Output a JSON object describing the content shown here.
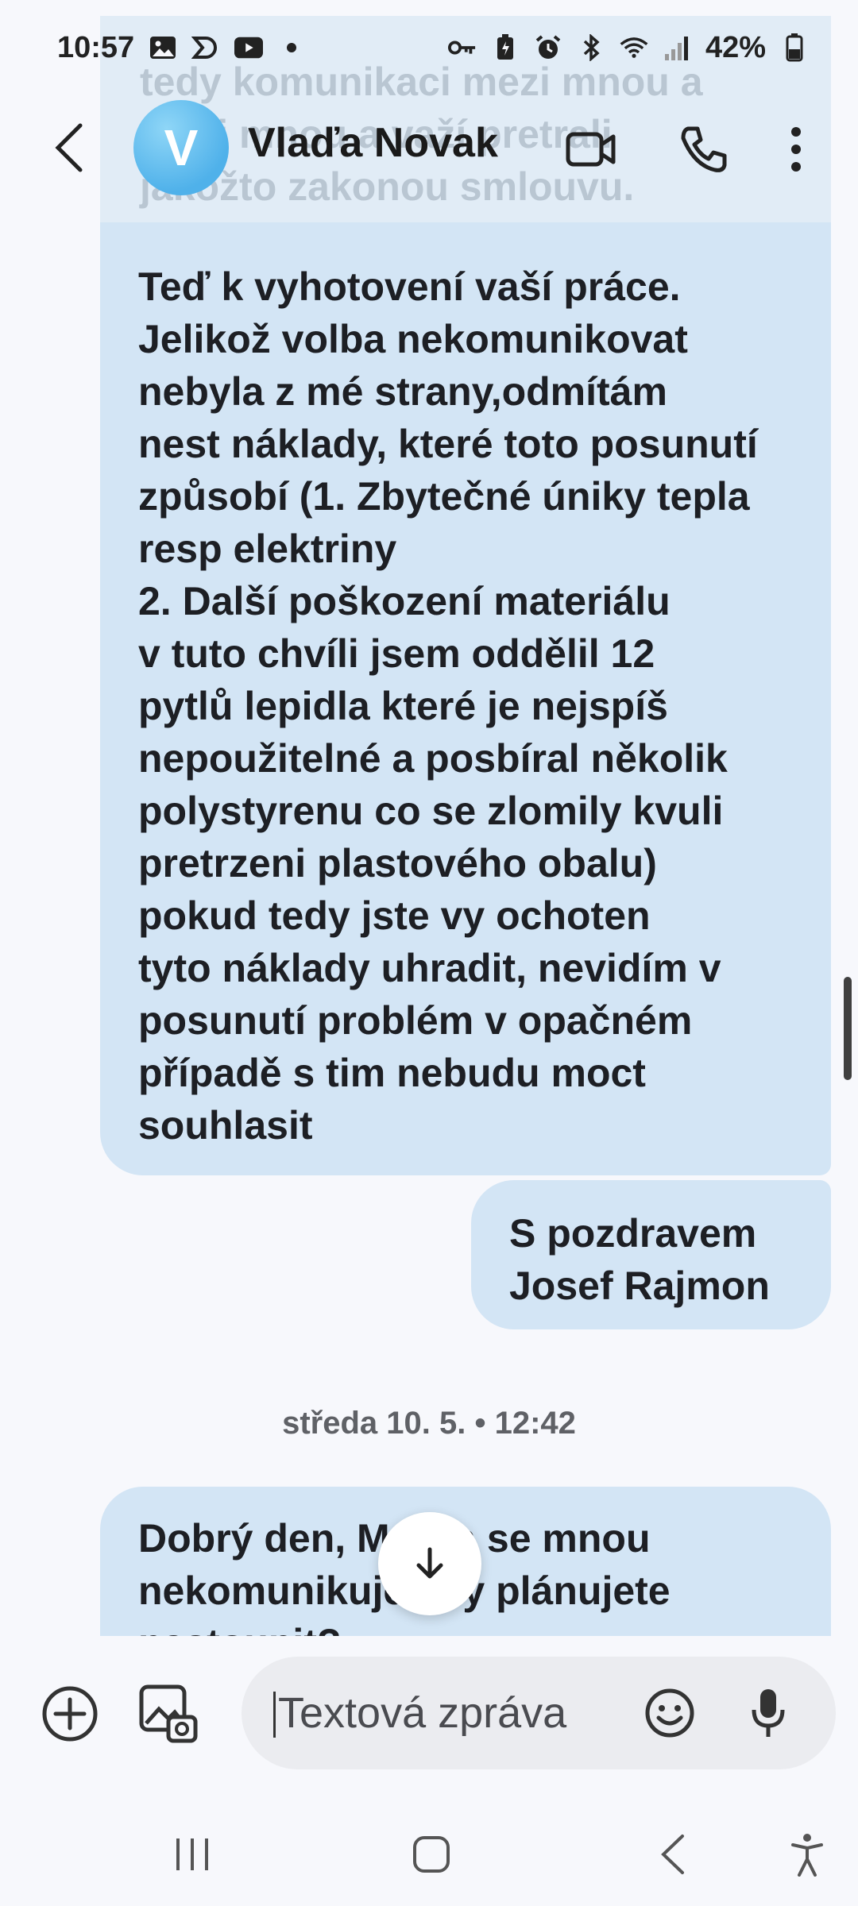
{
  "status_bar": {
    "time": "10:57",
    "battery": "42%"
  },
  "header": {
    "avatar_letter": "V",
    "contact_name": "Vlaďa Novak ..."
  },
  "messages": {
    "top_fragment": "tedy komunikaci mezi mnou a\nmezi mnou a važí pretrali\njakožto zakonou smlouvu.",
    "main": "Teď k vyhotovení vaší práce.\nJelikož volba nekomunikovat\nnebyla z mé strany,odmítám\nnest náklady, které toto posunutí\nzpůsobí (1. Zbytečné úniky tepla\nresp elektriny\n2. Další poškození materiálu\nv tuto chvíli jsem oddělil 12\npytlů lepidla které je nejspíš\nnepoužitelné a posbíral několik\npolystyrenu co se zlomily kvuli\npretrzeni plastového obalu)\npokud tedy jste vy ochoten\ntyto náklady uhradit, nevidím v\nposunutí problém v opačném\npřípadě s tim nebudu moct\nsouhlasit",
    "signature": "S pozdravem\nJosef Rajmon",
    "date_separator": "středa 10. 5. • 12:42",
    "latest": "Dobrý den,  Martin se mnou\nnekomunikuje kdy plánujete\nnastoupit?"
  },
  "composer": {
    "placeholder": "Textová zpráva"
  },
  "icons": {
    "back": "chevron-left-icon",
    "video": "video-camera-icon",
    "call": "phone-icon",
    "more": "more-vertical-icon",
    "scroll_down": "arrow-down-icon",
    "add": "plus-circle-icon",
    "gallery": "gallery-icon",
    "emoji": "emoji-icon",
    "mic": "microphone-icon"
  },
  "colors": {
    "bubble": "#d3e5f5",
    "background": "#f7f8fc",
    "avatar": "#4fb1ea"
  }
}
